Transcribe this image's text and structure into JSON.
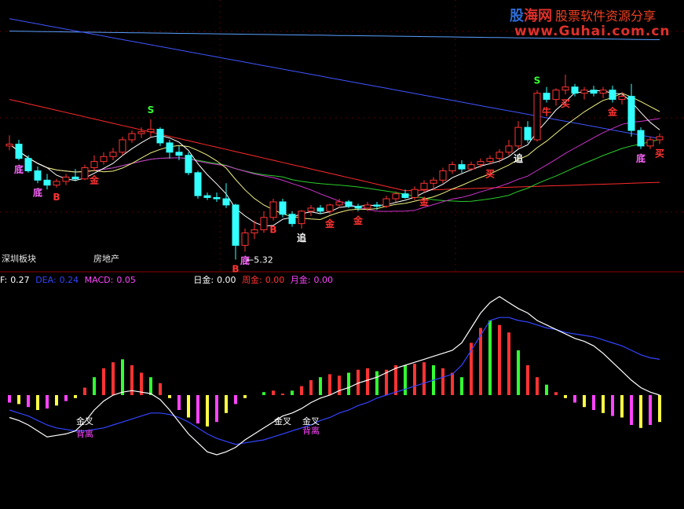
{
  "labels": {
    "region": "深圳板块",
    "sector": "房地产",
    "low_price": "5.32"
  },
  "logo": {
    "brand_a": "股",
    "brand_b": "海网",
    "slogan": "股票软件资源分享",
    "url": "www.Guhai.com.cn"
  },
  "indicators": [
    {
      "label": "F:",
      "value": "0.27",
      "color": "#ffffff"
    },
    {
      "label": "DEA:",
      "value": "0.24",
      "color": "#3344ff"
    },
    {
      "label": "MACD:",
      "value": "0.05",
      "color": "#ff44ff"
    },
    {
      "label": "日金:",
      "value": "0.00",
      "color": "#ffffff"
    },
    {
      "label": "周金:",
      "value": "0.00",
      "color": "#ff3333"
    },
    {
      "label": "月金:",
      "value": "0.00",
      "color": "#ff44ff"
    }
  ],
  "chart_data": [
    {
      "type": "candlestick",
      "colors": {
        "up": "#ff3333",
        "down": "#33ffff",
        "ma_long": "#4055ff",
        "ma_long2": "#5aa0ff",
        "ma60": "#ff2a2a",
        "ma30": "#2ccc2c",
        "ma20": "#cc33cc",
        "ma10": "#f0f080",
        "ma5": "#ffffff"
      },
      "ohlc": [
        [
          0,
          7.15,
          7.32,
          7.08,
          7.18
        ],
        [
          1,
          7.18,
          7.25,
          6.92,
          6.95
        ],
        [
          2,
          6.95,
          7.0,
          6.72,
          6.75
        ],
        [
          3,
          6.75,
          6.82,
          6.55,
          6.6
        ],
        [
          4,
          6.6,
          6.7,
          6.45,
          6.52
        ],
        [
          5,
          6.52,
          6.62,
          6.48,
          6.58
        ],
        [
          6,
          6.58,
          6.7,
          6.52,
          6.65
        ],
        [
          7,
          6.65,
          6.78,
          6.58,
          6.62
        ],
        [
          8,
          6.62,
          6.85,
          6.6,
          6.8
        ],
        [
          9,
          6.8,
          7.0,
          6.75,
          6.9
        ],
        [
          10,
          6.9,
          7.05,
          6.85,
          6.98
        ],
        [
          11,
          6.98,
          7.12,
          6.92,
          7.05
        ],
        [
          12,
          7.05,
          7.3,
          7.0,
          7.25
        ],
        [
          13,
          7.25,
          7.4,
          7.2,
          7.35
        ],
        [
          14,
          7.35,
          7.45,
          7.28,
          7.38
        ],
        [
          15,
          7.38,
          7.58,
          7.3,
          7.42
        ],
        [
          16,
          7.42,
          7.45,
          7.15,
          7.2
        ],
        [
          17,
          7.2,
          7.25,
          6.95,
          7.05
        ],
        [
          18,
          7.05,
          7.15,
          6.92,
          7.0
        ],
        [
          19,
          7.0,
          7.05,
          6.68,
          6.72
        ],
        [
          20,
          6.72,
          6.75,
          6.3,
          6.35
        ],
        [
          21,
          6.35,
          6.4,
          6.28,
          6.32
        ],
        [
          22,
          6.32,
          6.4,
          6.25,
          6.3
        ],
        [
          23,
          6.3,
          6.55,
          6.15,
          6.2
        ],
        [
          24,
          6.2,
          6.22,
          5.32,
          5.55
        ],
        [
          25,
          5.55,
          5.82,
          5.45,
          5.75
        ],
        [
          26,
          5.75,
          5.95,
          5.65,
          5.8
        ],
        [
          27,
          5.8,
          6.1,
          5.75,
          6.0
        ],
        [
          28,
          6.0,
          6.3,
          5.95,
          6.25
        ],
        [
          29,
          6.25,
          6.3,
          6.0,
          6.05
        ],
        [
          30,
          6.05,
          6.1,
          5.85,
          5.9
        ],
        [
          31,
          5.9,
          6.12,
          5.82,
          6.1
        ],
        [
          32,
          6.1,
          6.2,
          6.02,
          6.15
        ],
        [
          33,
          6.15,
          6.2,
          6.05,
          6.1
        ],
        [
          34,
          6.1,
          6.22,
          6.05,
          6.2
        ],
        [
          35,
          6.2,
          6.3,
          6.15,
          6.25
        ],
        [
          36,
          6.25,
          6.28,
          6.15,
          6.18
        ],
        [
          37,
          6.18,
          6.22,
          6.1,
          6.15
        ],
        [
          38,
          6.15,
          6.25,
          6.1,
          6.2
        ],
        [
          39,
          6.2,
          6.25,
          6.12,
          6.18
        ],
        [
          40,
          6.18,
          6.35,
          6.15,
          6.3
        ],
        [
          41,
          6.3,
          6.42,
          6.25,
          6.38
        ],
        [
          42,
          6.38,
          6.45,
          6.3,
          6.32
        ],
        [
          43,
          6.32,
          6.5,
          6.28,
          6.45
        ],
        [
          44,
          6.45,
          6.6,
          6.4,
          6.55
        ],
        [
          45,
          6.55,
          6.65,
          6.45,
          6.6
        ],
        [
          46,
          6.6,
          6.8,
          6.55,
          6.75
        ],
        [
          47,
          6.75,
          6.9,
          6.7,
          6.85
        ],
        [
          48,
          6.85,
          6.92,
          6.72,
          6.78
        ],
        [
          49,
          6.78,
          6.9,
          6.75,
          6.85
        ],
        [
          50,
          6.85,
          6.95,
          6.8,
          6.9
        ],
        [
          51,
          6.9,
          7.0,
          6.85,
          6.95
        ],
        [
          52,
          6.95,
          7.1,
          6.88,
          7.05
        ],
        [
          53,
          7.05,
          7.25,
          7.0,
          7.15
        ],
        [
          54,
          7.15,
          7.55,
          7.1,
          7.45
        ],
        [
          55,
          7.45,
          7.55,
          7.2,
          7.25
        ],
        [
          56,
          7.25,
          8.05,
          7.22,
          8.0
        ],
        [
          57,
          8.0,
          8.1,
          7.85,
          7.9
        ],
        [
          58,
          7.9,
          8.08,
          7.8,
          8.05
        ],
        [
          59,
          8.05,
          8.3,
          7.98,
          8.1
        ],
        [
          60,
          8.1,
          8.15,
          7.95,
          8.0
        ],
        [
          61,
          8.0,
          8.1,
          7.9,
          8.05
        ],
        [
          62,
          8.05,
          8.12,
          7.95,
          8.0
        ],
        [
          63,
          8.0,
          8.1,
          7.92,
          8.05
        ],
        [
          64,
          8.05,
          8.12,
          7.85,
          7.9
        ],
        [
          65,
          7.9,
          8.02,
          7.82,
          7.95
        ],
        [
          66,
          7.95,
          8.15,
          7.3,
          7.4
        ],
        [
          67,
          7.4,
          7.45,
          7.1,
          7.15
        ],
        [
          68,
          7.15,
          7.3,
          7.1,
          7.25
        ],
        [
          69,
          7.25,
          7.35,
          7.18,
          7.3
        ]
      ],
      "signals": [
        {
          "i": 1,
          "text": "底",
          "color": "#ff66ff"
        },
        {
          "i": 3,
          "text": "底",
          "color": "#ff66ff"
        },
        {
          "i": 5,
          "text": "B",
          "color": "#ff3333"
        },
        {
          "i": 9,
          "text": "金",
          "color": "#ff3333"
        },
        {
          "i": 15,
          "text": "S",
          "color": "#33ff33"
        },
        {
          "i": 24,
          "text": "B",
          "color": "#ff3333"
        },
        {
          "i": 25,
          "text": "底",
          "color": "#ff66ff"
        },
        {
          "i": 28,
          "text": "B",
          "color": "#ff3333"
        },
        {
          "i": 31,
          "text": "追",
          "color": "#ffffff"
        },
        {
          "i": 34,
          "text": "金",
          "color": "#ff3333"
        },
        {
          "i": 37,
          "text": "金",
          "color": "#ff3333"
        },
        {
          "i": 44,
          "text": "金",
          "color": "#ff3333"
        },
        {
          "i": 51,
          "text": "买",
          "color": "#ff3333"
        },
        {
          "i": 54,
          "text": "追",
          "color": "#ffffff"
        },
        {
          "i": 56,
          "text": "S",
          "color": "#33ff33"
        },
        {
          "i": 57,
          "text": "牛",
          "color": "#ff3333"
        },
        {
          "i": 59,
          "text": "买",
          "color": "#ff3333"
        },
        {
          "i": 64,
          "text": "金",
          "color": "#ff3333"
        },
        {
          "i": 67,
          "text": "底",
          "color": "#ff66ff"
        },
        {
          "i": 69,
          "text": "买",
          "color": "#ff3333"
        }
      ]
    },
    {
      "type": "bar",
      "series": [
        {
          "name": "MACD",
          "values": [
            -0.05,
            -0.06,
            -0.08,
            -0.1,
            -0.09,
            -0.07,
            -0.04,
            -0.02,
            0.05,
            0.12,
            0.18,
            0.22,
            0.24,
            0.2,
            0.15,
            0.12,
            0.08,
            -0.02,
            -0.1,
            -0.15,
            -0.19,
            -0.21,
            -0.18,
            -0.12,
            -0.06,
            -0.02,
            0.0,
            0.02,
            0.03,
            0.01,
            0.03,
            0.06,
            0.1,
            0.12,
            0.14,
            0.13,
            0.15,
            0.17,
            0.18,
            0.16,
            0.17,
            0.2,
            0.2,
            0.21,
            0.22,
            0.2,
            0.18,
            0.15,
            0.12,
            0.35,
            0.45,
            0.5,
            0.47,
            0.42,
            0.3,
            0.2,
            0.12,
            0.07,
            0.02,
            -0.02,
            -0.05,
            -0.08,
            -0.1,
            -0.12,
            -0.14,
            -0.15,
            -0.2,
            -0.22,
            -0.2,
            -0.18
          ]
        },
        {
          "name": "DIF",
          "values": [
            -0.15,
            -0.17,
            -0.2,
            -0.24,
            -0.28,
            -0.27,
            -0.26,
            -0.24,
            -0.18,
            -0.1,
            -0.04,
            0.0,
            0.02,
            0.03,
            0.02,
            0.01,
            -0.03,
            -0.1,
            -0.18,
            -0.26,
            -0.32,
            -0.38,
            -0.4,
            -0.38,
            -0.35,
            -0.3,
            -0.26,
            -0.22,
            -0.18,
            -0.14,
            -0.12,
            -0.09,
            -0.05,
            -0.02,
            0.0,
            0.03,
            0.05,
            0.08,
            0.1,
            0.12,
            0.15,
            0.18,
            0.2,
            0.22,
            0.24,
            0.26,
            0.28,
            0.3,
            0.35,
            0.45,
            0.55,
            0.62,
            0.66,
            0.62,
            0.58,
            0.55,
            0.5,
            0.47,
            0.44,
            0.41,
            0.38,
            0.36,
            0.33,
            0.28,
            0.22,
            0.16,
            0.1,
            0.05,
            0.02,
            0.0
          ]
        },
        {
          "name": "DEA",
          "values": [
            -0.1,
            -0.12,
            -0.14,
            -0.17,
            -0.2,
            -0.22,
            -0.23,
            -0.24,
            -0.24,
            -0.23,
            -0.22,
            -0.2,
            -0.18,
            -0.16,
            -0.14,
            -0.12,
            -0.12,
            -0.13,
            -0.15,
            -0.18,
            -0.22,
            -0.26,
            -0.29,
            -0.31,
            -0.33,
            -0.32,
            -0.31,
            -0.3,
            -0.28,
            -0.26,
            -0.24,
            -0.22,
            -0.2,
            -0.17,
            -0.15,
            -0.12,
            -0.1,
            -0.07,
            -0.05,
            -0.02,
            0.0,
            0.02,
            0.04,
            0.06,
            0.08,
            0.1,
            0.12,
            0.14,
            0.2,
            0.3,
            0.4,
            0.5,
            0.52,
            0.52,
            0.5,
            0.49,
            0.47,
            0.45,
            0.44,
            0.42,
            0.41,
            0.4,
            0.39,
            0.37,
            0.35,
            0.33,
            0.3,
            0.27,
            0.25,
            0.24
          ]
        }
      ],
      "notes": [
        {
          "i": 8,
          "text": "金叉",
          "color": "#ffffff",
          "dy": 0
        },
        {
          "i": 8,
          "text": "背离",
          "color": "#ff44ff",
          "dy": 16
        },
        {
          "i": 29,
          "text": "金叉",
          "color": "#ffffff",
          "dy": 0
        },
        {
          "i": 32,
          "text": "金叉",
          "color": "#ffffff",
          "dy": 0
        },
        {
          "i": 32,
          "text": "背离",
          "color": "#ff44ff",
          "dy": 12
        }
      ]
    }
  ]
}
